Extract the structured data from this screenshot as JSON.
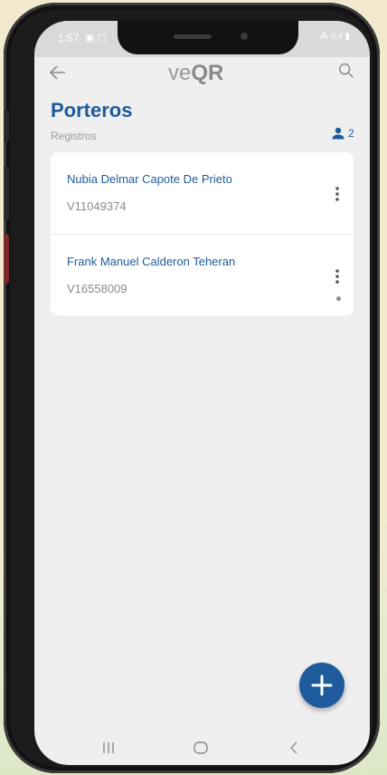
{
  "status_bar": {
    "time": "1:57",
    "icons": "▣ ▢",
    "signal": "⁂.ıl.ıl ▮"
  },
  "app_bar": {
    "logo_prefix": "ve",
    "logo_suffix": "QR",
    "back_icon": "arrow-left-icon",
    "search_icon": "search-icon"
  },
  "header": {
    "title": "Porteros",
    "subtitle": "Registros",
    "count": "2",
    "count_icon": "person-icon"
  },
  "list": {
    "items": [
      {
        "name": "Nubia Delmar Capote De Prieto",
        "id": "V11049374"
      },
      {
        "name": "Frank Manuel Calderon Teheran",
        "id": "V16558009"
      }
    ]
  },
  "fab": {
    "icon": "plus-icon"
  },
  "nav_bar": {
    "recents_icon": "recents-icon",
    "home_icon": "home-icon",
    "back_icon": "back-chevron-icon"
  },
  "colors": {
    "accent": "#1e5b9c",
    "background": "#efefef",
    "card": "#ffffff"
  }
}
